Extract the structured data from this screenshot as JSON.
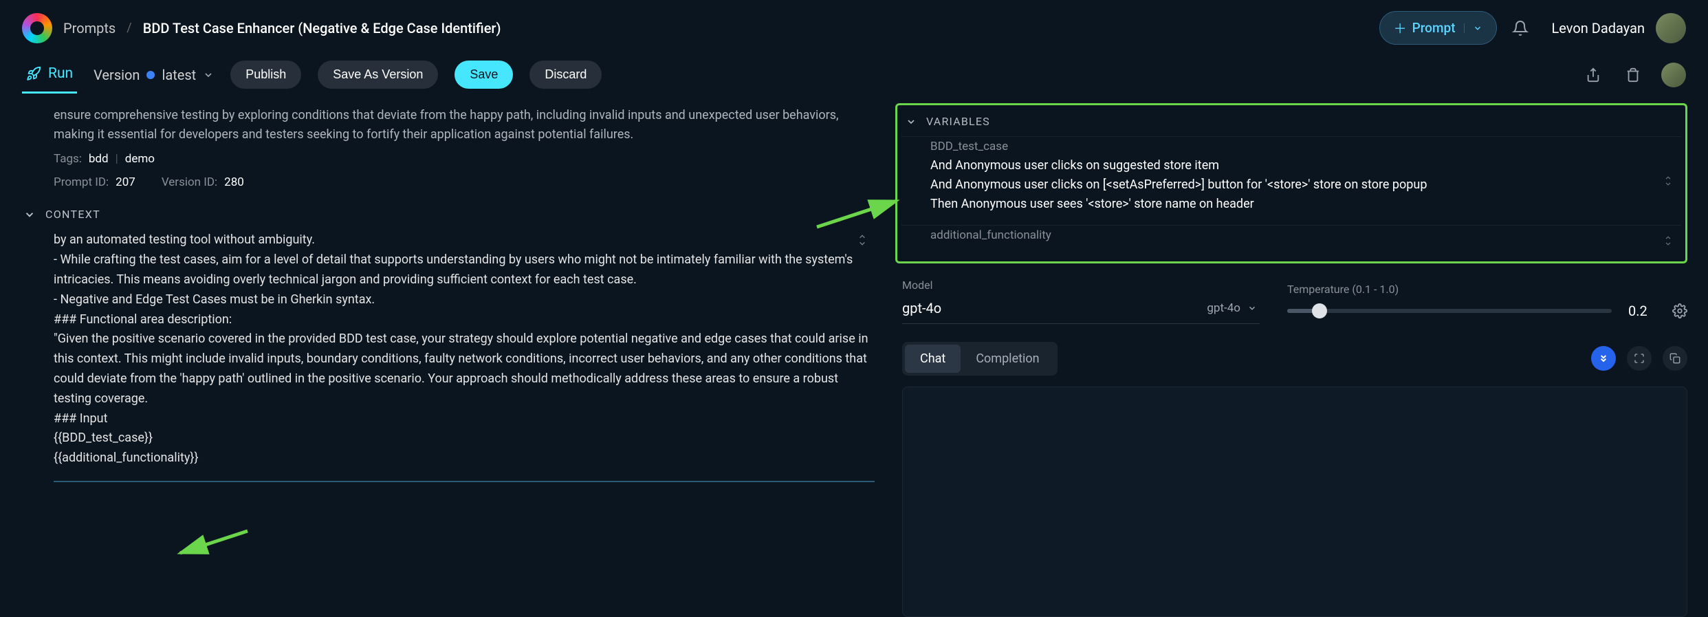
{
  "header": {
    "breadcrumb_root": "Prompts",
    "breadcrumb_current": "BDD Test Case Enhancer (Negative & Edge Case Identifier)",
    "prompt_button": "Prompt",
    "username": "Levon Dadayan"
  },
  "toolbar": {
    "run_tab": "Run",
    "version_tab": "Version",
    "version_badge": "latest",
    "publish": "Publish",
    "save_as_version": "Save As Version",
    "save": "Save",
    "discard": "Discard"
  },
  "left": {
    "description": "ensure comprehensive testing by exploring conditions that deviate from the happy path, including invalid inputs and unexpected user behaviors, making it essential for developers and testers seeking to fortify their application against potential failures.",
    "tags_label": "Tags:",
    "tags": [
      "bdd",
      "demo"
    ],
    "prompt_id_label": "Prompt ID:",
    "prompt_id": "207",
    "version_id_label": "Version ID:",
    "version_id": "280",
    "context_label": "CONTEXT",
    "context_lines": [
      "by an automated testing tool without ambiguity.",
      "- While crafting the test cases, aim for a level of detail that supports understanding by users who might not be intimately familiar with the system's intricacies. This means avoiding overly technical jargon and providing sufficient context for each test case.",
      "- Negative and Edge Test Cases must be in Gherkin syntax.",
      "",
      "### Functional area description:",
      "\"Given the positive scenario covered in the provided BDD test case, your strategy should explore potential negative and edge cases that could arise in this context. This might include invalid inputs, boundary conditions, faulty network conditions, incorrect user behaviors, and any other conditions that could deviate from the 'happy path' outlined in the positive scenario. Your approach should methodically address these areas to ensure a robust testing coverage.",
      "",
      "### Input",
      "{{BDD_test_case}}",
      "{{additional_functionality}}"
    ]
  },
  "right": {
    "variables_label": "VARIABLES",
    "var1_name": "BDD_test_case",
    "var1_value": "And Anonymous user clicks on suggested store item\nAnd Anonymous user clicks on [<setAsPreferred>] button for '<store>' store on store popup\nThen Anonymous user sees '<store>' store name on header",
    "var2_name": "additional_functionality",
    "model_label": "Model",
    "model_value": "gpt-4o",
    "model_selected": "gpt-4o",
    "temp_label": "Temperature (0.1 - 1.0)",
    "temp_value": "0.2",
    "chat_tab": "Chat",
    "completion_tab": "Completion"
  }
}
